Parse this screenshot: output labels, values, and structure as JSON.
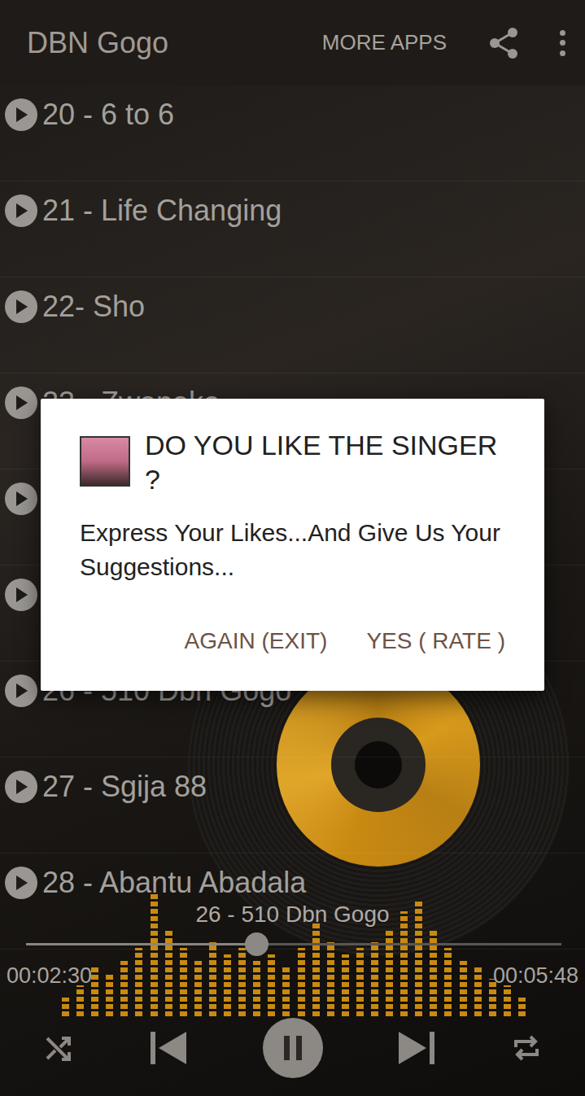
{
  "app_bar": {
    "title": "DBN Gogo",
    "more_apps": "MORE APPS"
  },
  "tracks": [
    {
      "title": "20 - 6 to 6"
    },
    {
      "title": "21 - Life Changing"
    },
    {
      "title": "22- Sho"
    },
    {
      "title": "23 - Zwanako"
    },
    {
      "title": ""
    },
    {
      "title": ""
    },
    {
      "title": "26 - 510 Dbn Gogo"
    },
    {
      "title": "27 - Sgija 88"
    },
    {
      "title": "28 - Abantu Abadala"
    }
  ],
  "dialog": {
    "title": "DO YOU LIKE THE SINGER ?",
    "message": "Express Your Likes...And Give Us Your Suggestions...",
    "buttons": [
      "AGAIN (EXIT)",
      "YES ( RATE )"
    ]
  },
  "player": {
    "now_playing": "26 - 510 Dbn Gogo",
    "elapsed": "00:02:30",
    "duration": "00:05:48",
    "level": 0.43,
    "playing": true,
    "visualizer": [
      0.15,
      0.25,
      0.4,
      0.35,
      0.45,
      0.55,
      1.0,
      0.7,
      0.55,
      0.45,
      0.6,
      0.5,
      0.55,
      0.45,
      0.5,
      0.4,
      0.55,
      0.75,
      0.6,
      0.5,
      0.55,
      0.6,
      0.7,
      0.85,
      0.95,
      0.7,
      0.55,
      0.45,
      0.4,
      0.3,
      0.25,
      0.15
    ]
  }
}
